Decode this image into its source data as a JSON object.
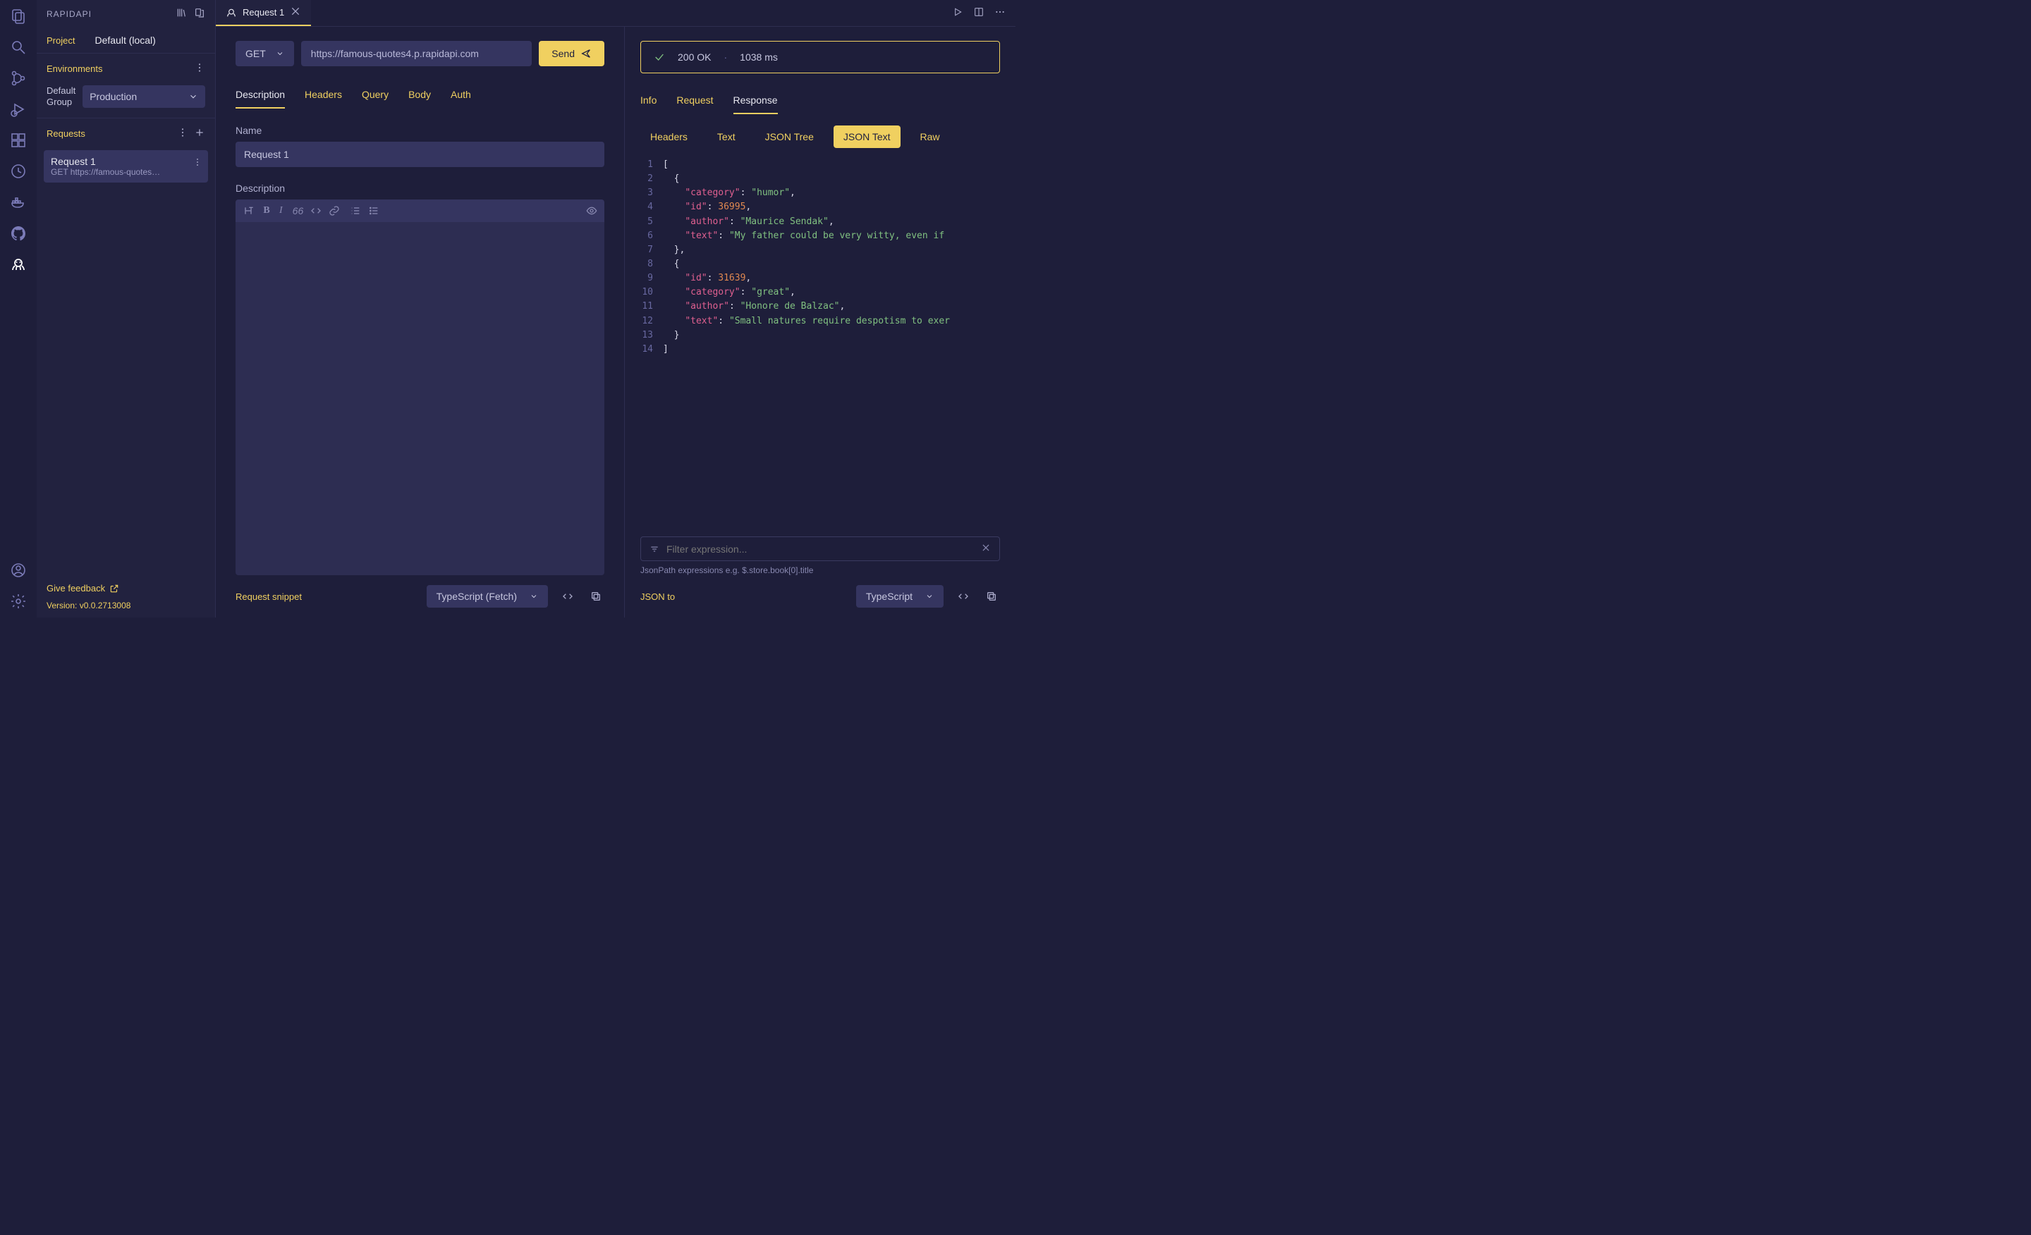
{
  "sidebar": {
    "title": "RAPIDAPI",
    "project_label": "Project",
    "project_value": "Default (local)",
    "environments_label": "Environments",
    "env_group_label": "Default\nGroup",
    "env_select_value": "Production",
    "requests_label": "Requests",
    "request_item": {
      "title": "Request 1",
      "subtitle": "GET https://famous-quotes…"
    },
    "feedback_label": "Give feedback",
    "version_label": "Version: v0.0.2713008"
  },
  "tab": {
    "label": "Request 1"
  },
  "request": {
    "method": "GET",
    "url": "https://famous-quotes4.p.rapidapi.com",
    "send_label": "Send",
    "tabs": [
      "Description",
      "Headers",
      "Query",
      "Body",
      "Auth"
    ],
    "name_label": "Name",
    "name_value": "Request 1",
    "description_label": "Description",
    "snippet_label": "Request snippet",
    "snippet_lang": "TypeScript (Fetch)"
  },
  "response": {
    "status_text": "200 OK",
    "time_text": "1038 ms",
    "tabs": [
      "Info",
      "Request",
      "Response"
    ],
    "subtabs": [
      "Headers",
      "Text",
      "JSON Tree",
      "JSON Text",
      "Raw"
    ],
    "json_lines": [
      {
        "n": 1,
        "tokens": [
          {
            "t": "punc",
            "v": "["
          }
        ]
      },
      {
        "n": 2,
        "tokens": [
          {
            "t": "punc",
            "v": "  {"
          }
        ]
      },
      {
        "n": 3,
        "tokens": [
          {
            "t": "punc",
            "v": "    "
          },
          {
            "t": "key",
            "v": "\"category\""
          },
          {
            "t": "punc",
            "v": ": "
          },
          {
            "t": "str",
            "v": "\"humor\""
          },
          {
            "t": "punc",
            "v": ","
          }
        ]
      },
      {
        "n": 4,
        "tokens": [
          {
            "t": "punc",
            "v": "    "
          },
          {
            "t": "key",
            "v": "\"id\""
          },
          {
            "t": "punc",
            "v": ": "
          },
          {
            "t": "num",
            "v": "36995"
          },
          {
            "t": "punc",
            "v": ","
          }
        ]
      },
      {
        "n": 5,
        "tokens": [
          {
            "t": "punc",
            "v": "    "
          },
          {
            "t": "key",
            "v": "\"author\""
          },
          {
            "t": "punc",
            "v": ": "
          },
          {
            "t": "str",
            "v": "\"Maurice Sendak\""
          },
          {
            "t": "punc",
            "v": ","
          }
        ]
      },
      {
        "n": 6,
        "tokens": [
          {
            "t": "punc",
            "v": "    "
          },
          {
            "t": "key",
            "v": "\"text\""
          },
          {
            "t": "punc",
            "v": ": "
          },
          {
            "t": "str",
            "v": "\"My father could be very witty, even if "
          }
        ]
      },
      {
        "n": 7,
        "tokens": [
          {
            "t": "punc",
            "v": "  },"
          }
        ]
      },
      {
        "n": 8,
        "tokens": [
          {
            "t": "punc",
            "v": "  {"
          }
        ]
      },
      {
        "n": 9,
        "tokens": [
          {
            "t": "punc",
            "v": "    "
          },
          {
            "t": "key",
            "v": "\"id\""
          },
          {
            "t": "punc",
            "v": ": "
          },
          {
            "t": "num",
            "v": "31639"
          },
          {
            "t": "punc",
            "v": ","
          }
        ]
      },
      {
        "n": 10,
        "tokens": [
          {
            "t": "punc",
            "v": "    "
          },
          {
            "t": "key",
            "v": "\"category\""
          },
          {
            "t": "punc",
            "v": ": "
          },
          {
            "t": "str",
            "v": "\"great\""
          },
          {
            "t": "punc",
            "v": ","
          }
        ]
      },
      {
        "n": 11,
        "tokens": [
          {
            "t": "punc",
            "v": "    "
          },
          {
            "t": "key",
            "v": "\"author\""
          },
          {
            "t": "punc",
            "v": ": "
          },
          {
            "t": "str",
            "v": "\"Honore de Balzac\""
          },
          {
            "t": "punc",
            "v": ","
          }
        ]
      },
      {
        "n": 12,
        "tokens": [
          {
            "t": "punc",
            "v": "    "
          },
          {
            "t": "key",
            "v": "\"text\""
          },
          {
            "t": "punc",
            "v": ": "
          },
          {
            "t": "str",
            "v": "\"Small natures require despotism to exer"
          }
        ]
      },
      {
        "n": 13,
        "tokens": [
          {
            "t": "punc",
            "v": "  }"
          }
        ]
      },
      {
        "n": 14,
        "tokens": [
          {
            "t": "punc",
            "v": "]"
          }
        ]
      }
    ],
    "filter_placeholder": "Filter expression...",
    "filter_hint": "JsonPath expressions e.g. $.store.book[0].title",
    "jsonto_label": "JSON to",
    "jsonto_lang": "TypeScript"
  }
}
